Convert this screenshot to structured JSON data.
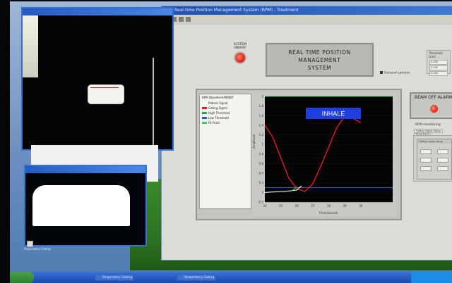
{
  "window": {
    "title": "Real-time Position Management System (RPM) - Treatment"
  },
  "panel": {
    "system_onoff_label": "SYSTEM ON/OFF",
    "title_line1": "REAL TIME POSITION MANAGEMENT",
    "title_line2": "SYSTEM",
    "general_camera_label": "General camera",
    "threshold_title": "Threshold Limit",
    "threshold_values": [
      "0.000",
      "0.000",
      "0.000"
    ],
    "beam_off_alarm": "BEAM OFF ALARM",
    "rpm_monitoring_label": "RPM monitoring",
    "rpm_tabs": [
      "Gating Signal Setup",
      "Start Time"
    ],
    "gating_setup_title": "Gating signal setup"
  },
  "legend": {
    "header": "RPM Waveform/MONIT",
    "items": [
      {
        "label": "Patient Signal",
        "color": "#ffffff"
      },
      {
        "label": "Gating Signal",
        "color": "#d92020"
      },
      {
        "label": "High Threshold",
        "color": "#2da84a"
      },
      {
        "label": "Low Threshold",
        "color": "#2a59d6"
      },
      {
        "label": "Fit Point",
        "color": "#34d058"
      }
    ]
  },
  "chart_data": {
    "type": "line",
    "annotation": "INHALE",
    "xlabel": "Time(second)",
    "ylabel": "Amplitude",
    "xlim": [
      24,
      32
    ],
    "ylim": [
      -0.2,
      2.0
    ],
    "x_ticks": [
      "24",
      "25",
      "26",
      "27",
      "28",
      "29",
      "30"
    ],
    "y_ticks": [
      "2",
      "1.8",
      "1.6",
      "1.4",
      "1.2",
      "1",
      "0.8",
      "0.6",
      "0.4",
      "0.2",
      "0",
      "-0.2"
    ],
    "series": [
      {
        "name": "Gating Signal",
        "color": "#e02020",
        "x": [
          24.0,
          24.5,
          25.0,
          25.5,
          26.0,
          26.5,
          27.0,
          27.5,
          28.0,
          28.5,
          29.0,
          29.5,
          30.0
        ],
        "y": [
          1.4,
          1.15,
          0.72,
          0.3,
          0.08,
          0.02,
          0.18,
          0.55,
          0.95,
          1.35,
          1.58,
          1.55,
          1.45
        ]
      },
      {
        "name": "Patient Signal",
        "color": "#ffffff",
        "x": [
          24.0,
          24.5,
          25.0,
          25.5,
          26.0,
          26.3
        ],
        "y": [
          0.0,
          0.01,
          0.02,
          0.03,
          0.05,
          0.14
        ]
      },
      {
        "name": "Fit Point",
        "color": "#34d058",
        "x": [
          25.6,
          25.8,
          26.0
        ],
        "y": [
          0.02,
          0.06,
          0.12
        ]
      }
    ],
    "high_threshold": 2.0,
    "low_threshold": 0.1
  },
  "taskbar": {
    "buttons": [
      "Respiratory Gating",
      "Respiratory Gating"
    ]
  },
  "desktop": {
    "icon_label": "Respiratory Gating"
  }
}
